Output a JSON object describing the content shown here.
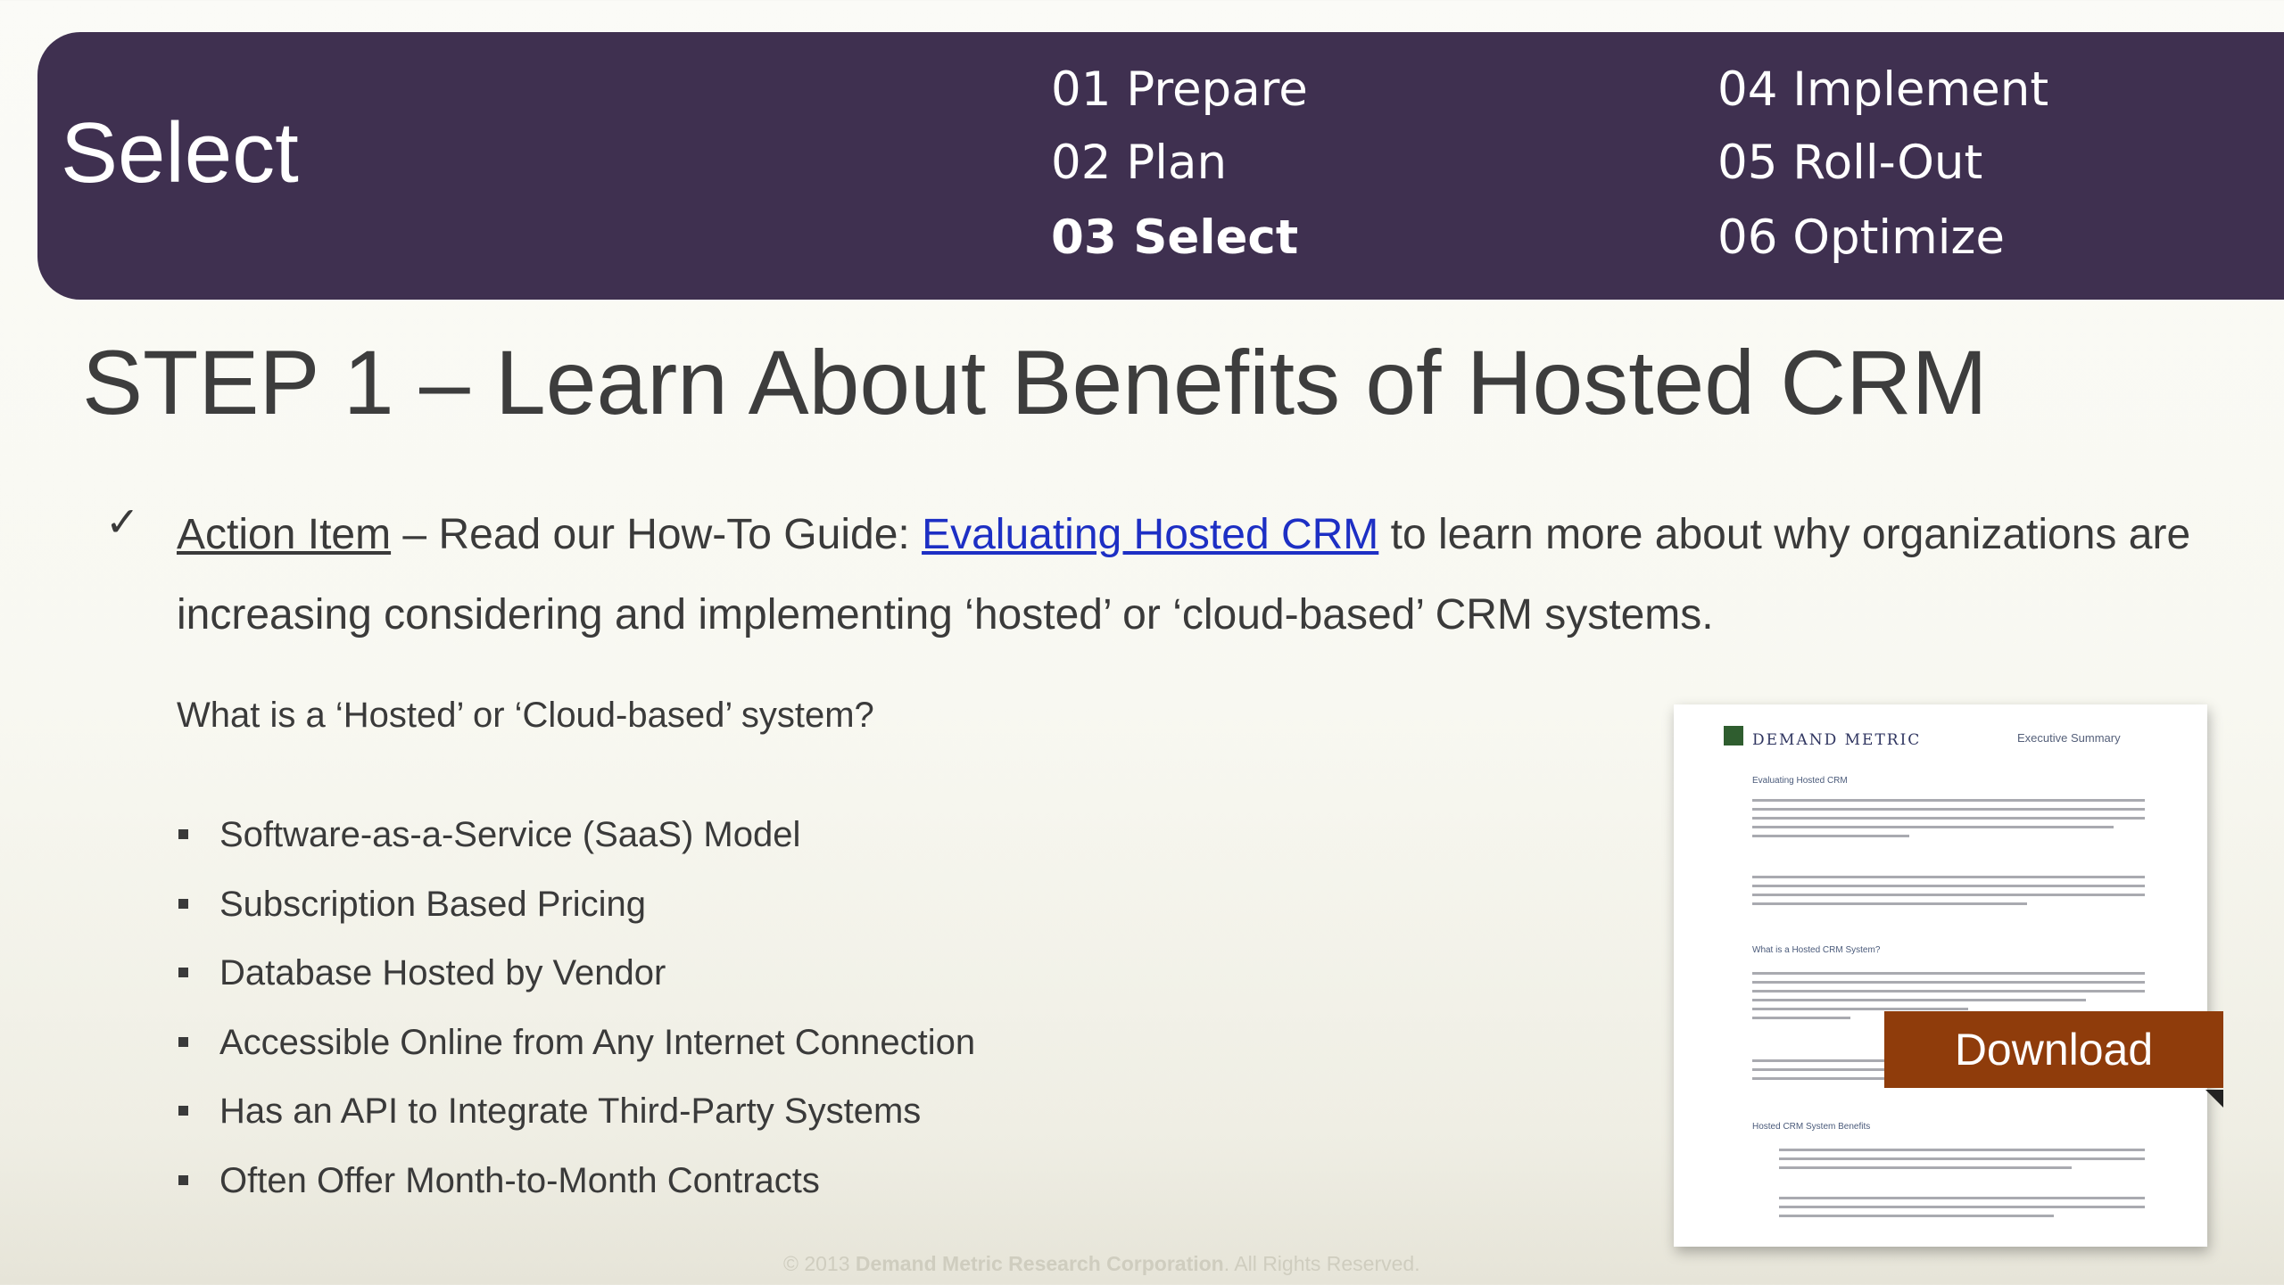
{
  "banner": {
    "title": "Select",
    "steps": [
      {
        "label": "01 Prepare"
      },
      {
        "label": "02 Plan"
      },
      {
        "label": "03 Select"
      },
      {
        "label": "04 Implement"
      },
      {
        "label": "05 Roll-Out"
      },
      {
        "label": "06 Optimize"
      }
    ],
    "active_step": "03 Select",
    "color": "#3f3050"
  },
  "heading": "STEP 1 – Learn About Benefits of Hosted CRM",
  "action": {
    "check": "✓",
    "label": "Action Item",
    "text_before_link": " – Read our How-To Guide: ",
    "link": "Evaluating Hosted CRM",
    "text_after_link": " to learn more about why organizations are increasing considering and implementing ‘hosted’ or ‘cloud-based’ CRM systems."
  },
  "question": "What is a ‘Hosted’ or ‘Cloud-based’ system?",
  "bullets": [
    "Software-as-a-Service (SaaS) Model",
    "Subscription Based Pricing",
    "Database Hosted by Vendor",
    "Accessible Online from Any Internet Connection",
    "Has an API to Integrate Third-Party Systems",
    "Often Offer Month-to-Month Contracts"
  ],
  "document_preview": {
    "brand": "DEMAND METRIC",
    "label": "Executive Summary",
    "section_1": "Evaluating Hosted CRM",
    "section_2": "What is a Hosted CRM System?",
    "section_3": "Hosted CRM System Benefits"
  },
  "download_label": "Download",
  "download_color": "#8f3c0b",
  "footer": {
    "prefix": "© 2013 ",
    "company": "Demand Metric Research Corporation",
    "suffix": ". All Rights Reserved."
  }
}
